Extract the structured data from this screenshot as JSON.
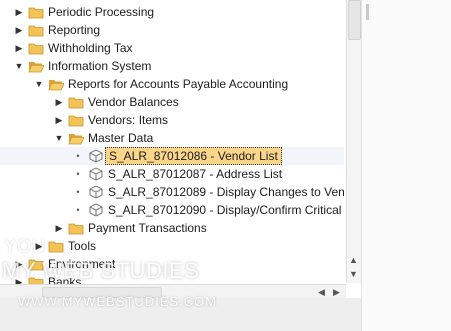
{
  "tree": {
    "items": [
      {
        "label": "Periodic Processing",
        "toggle": "▶",
        "icon": "folder-icon"
      },
      {
        "label": "Reporting",
        "toggle": "▶",
        "icon": "folder-icon"
      },
      {
        "label": "Withholding Tax",
        "toggle": "▶",
        "icon": "folder-icon"
      },
      {
        "label": "Information System",
        "toggle": "▼",
        "icon": "folder-open-icon"
      },
      {
        "label": "Reports for Accounts Payable Accounting",
        "toggle": "▼",
        "icon": "folder-open-icon"
      },
      {
        "label": "Vendor Balances",
        "toggle": "▶",
        "icon": "folder-icon"
      },
      {
        "label": "Vendors: Items",
        "toggle": "▶",
        "icon": "folder-icon"
      },
      {
        "label": "Master Data",
        "toggle": "▼",
        "icon": "folder-open-icon"
      },
      {
        "label": "S_ALR_87012086 - Vendor List",
        "bullet": "•",
        "icon": "transaction-cube-icon",
        "selected": true
      },
      {
        "label": "S_ALR_87012087 - Address List",
        "bullet": "•",
        "icon": "transaction-cube-icon"
      },
      {
        "label": "S_ALR_87012089 - Display Changes to Ven",
        "bullet": "•",
        "icon": "transaction-cube-icon"
      },
      {
        "label": "S_ALR_87012090 - Display/Confirm Critical V",
        "bullet": "•",
        "icon": "transaction-cube-icon"
      },
      {
        "label": "Payment Transactions",
        "toggle": "▶",
        "icon": "folder-icon"
      },
      {
        "label": "Tools",
        "toggle": "▶",
        "icon": "folder-icon"
      },
      {
        "label": "Environment",
        "toggle": "▶",
        "icon": "folder-icon"
      },
      {
        "label": "Banks",
        "toggle": "▶",
        "icon": "folder-icon"
      }
    ]
  },
  "scrollbars": {
    "up_arrow": "▲",
    "down_arrow": "▼",
    "left_arrow": "◀",
    "right_arrow": "▶"
  },
  "watermark": {
    "line1": "YOU",
    "line2": "MY WEB STUDIES",
    "line3": "WWW.MYWEBSTUDIES.COM"
  },
  "colors": {
    "selection": "#fbd58a",
    "folder": "#f3c356",
    "folder_dark": "#d9a233"
  }
}
